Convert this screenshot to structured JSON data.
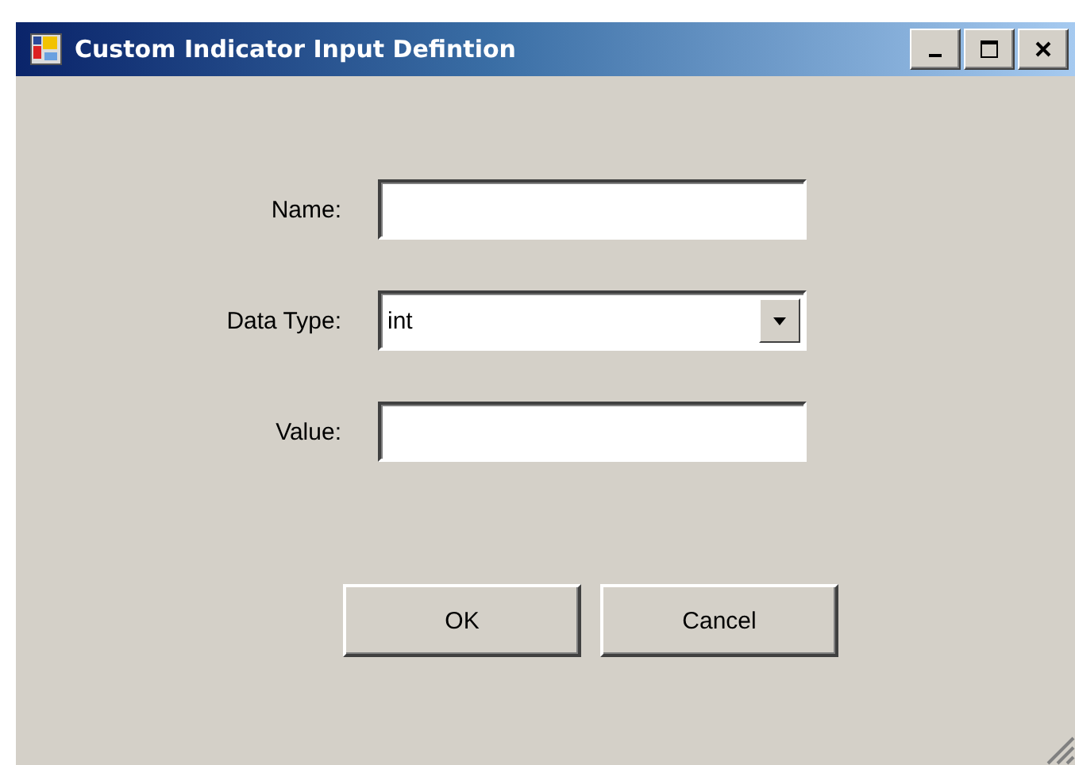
{
  "window": {
    "title": "Custom Indicator Input Defintion"
  },
  "fields": [
    {
      "label": "Name:",
      "kind": "text"
    },
    {
      "label": "Data Type:",
      "kind": "dropdown",
      "value": "int"
    },
    {
      "label": "Value:",
      "kind": "text"
    }
  ],
  "buttons": [
    "OK",
    "Cancel"
  ]
}
